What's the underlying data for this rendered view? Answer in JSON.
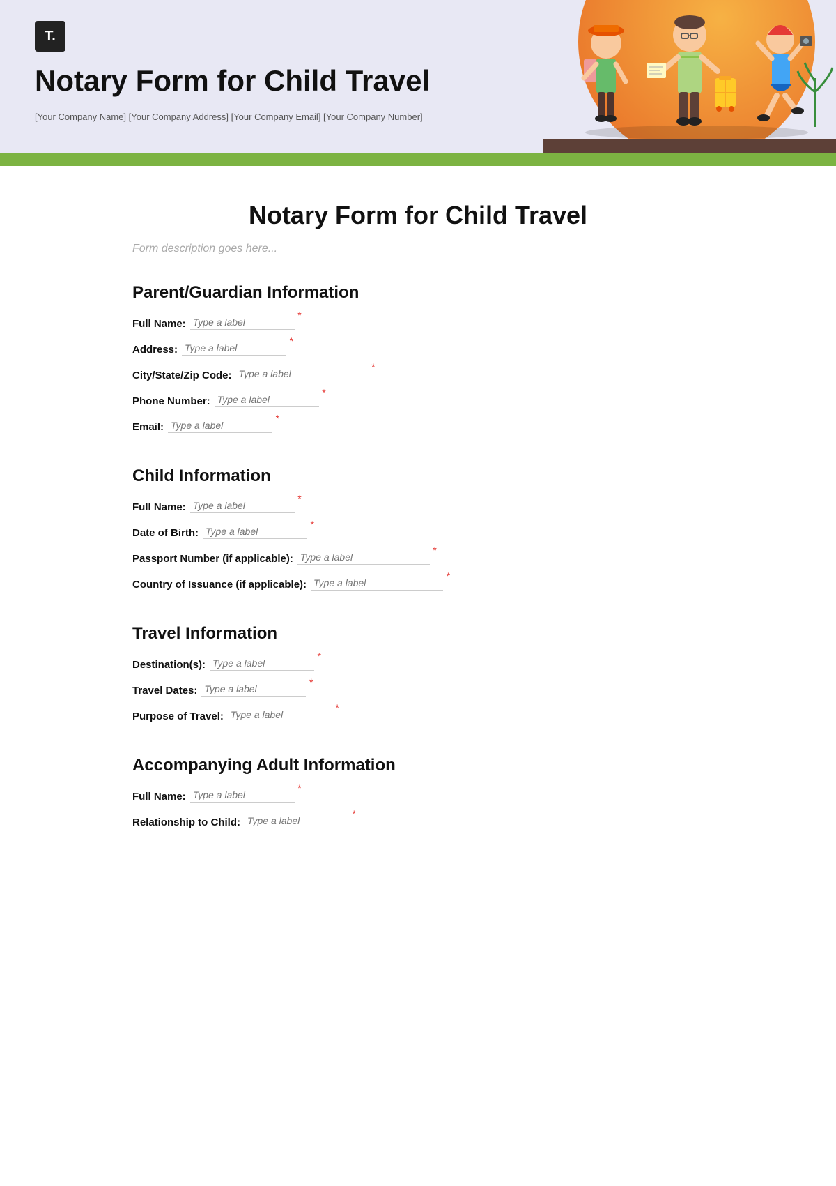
{
  "header": {
    "logo_text": "T.",
    "title": "Notary Form for Child Travel",
    "meta": "[Your Company Name] [Your Company Address] [Your Company Email] [Your Company Number]"
  },
  "form": {
    "title": "Notary Form for Child Travel",
    "description": "Form description goes here...",
    "sections": [
      {
        "id": "parent-guardian",
        "title": "Parent/Guardian Information",
        "fields": [
          {
            "label": "Full Name:",
            "placeholder": "Type a label",
            "required": true,
            "size": "default"
          },
          {
            "label": "Address:",
            "placeholder": "Type a label",
            "required": true,
            "size": "default"
          },
          {
            "label": "City/State/Zip Code:",
            "placeholder": "Type a label",
            "required": true,
            "size": "medium"
          },
          {
            "label": "Phone Number:",
            "placeholder": "Type a label",
            "required": true,
            "size": "default"
          },
          {
            "label": "Email:",
            "placeholder": "Type a label",
            "required": true,
            "size": "default"
          }
        ]
      },
      {
        "id": "child-info",
        "title": "Child Information",
        "fields": [
          {
            "label": "Full Name:",
            "placeholder": "Type a label",
            "required": true,
            "size": "default"
          },
          {
            "label": "Date of Birth:",
            "placeholder": "Type a label",
            "required": true,
            "size": "default"
          },
          {
            "label": "Passport Number (if applicable):",
            "placeholder": "Type a label",
            "required": true,
            "size": "medium"
          },
          {
            "label": "Country of Issuance (if applicable):",
            "placeholder": "Type a label",
            "required": true,
            "size": "medium"
          }
        ]
      },
      {
        "id": "travel-info",
        "title": "Travel Information",
        "fields": [
          {
            "label": "Destination(s):",
            "placeholder": "Type a label",
            "required": true,
            "size": "default"
          },
          {
            "label": "Travel Dates:",
            "placeholder": "Type a label",
            "required": true,
            "size": "default"
          },
          {
            "label": "Purpose of Travel:",
            "placeholder": "Type a label",
            "required": true,
            "size": "default"
          }
        ]
      },
      {
        "id": "accompanying-adult",
        "title": "Accompanying Adult Information",
        "fields": [
          {
            "label": "Full Name:",
            "placeholder": "Type a label",
            "required": true,
            "size": "default"
          },
          {
            "label": "Relationship to Child:",
            "placeholder": "Type a label",
            "required": true,
            "size": "default"
          }
        ]
      }
    ]
  }
}
